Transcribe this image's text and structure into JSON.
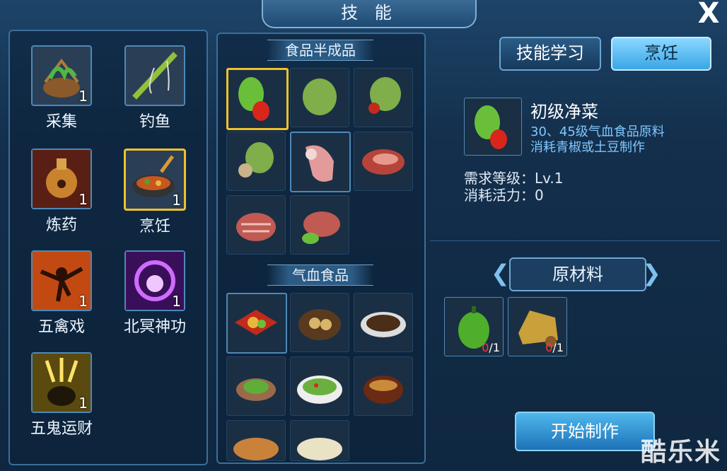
{
  "window": {
    "title": "技 能",
    "close_label": "X"
  },
  "skills": [
    {
      "label": "采集",
      "count": "1",
      "icon": "gathering-basket-icon"
    },
    {
      "label": "钓鱼",
      "count": "",
      "icon": "fishing-rod-icon"
    },
    {
      "label": "炼药",
      "count": "1",
      "icon": "alchemy-furnace-icon"
    },
    {
      "label": "烹饪",
      "count": "1",
      "icon": "cooking-wok-icon"
    },
    {
      "label": "五禽戏",
      "count": "1",
      "icon": "five-animals-icon"
    },
    {
      "label": "北冥神功",
      "count": "1",
      "icon": "beiming-power-icon"
    },
    {
      "label": "五鬼运财",
      "count": "1",
      "icon": "five-ghosts-wealth-icon"
    }
  ],
  "sections": {
    "semi": "食品半成品",
    "hp": "气血食品"
  },
  "tabs": {
    "learn": "技能学习",
    "cook": "烹饪"
  },
  "detail": {
    "name": "初级净菜",
    "desc1": "30、45级气血食品原料",
    "desc2": "消耗青椒或土豆制作",
    "level": "需求等级：Lv.1",
    "energy": "消耗活力：0"
  },
  "materials": {
    "title": "原材料",
    "items": [
      {
        "icon": "green-pepper-icon",
        "have": "0",
        "need": "/1"
      },
      {
        "icon": "potato-sack-icon",
        "have": "0",
        "need": "/1"
      }
    ]
  },
  "start_button": "开始制作",
  "watermark": "酷乐米",
  "colors": {
    "accent": "#f0c12c",
    "panel_border": "#3a6f9a",
    "button_blue": "#3aa6e6",
    "shortage_red": "#ff3b3b"
  }
}
